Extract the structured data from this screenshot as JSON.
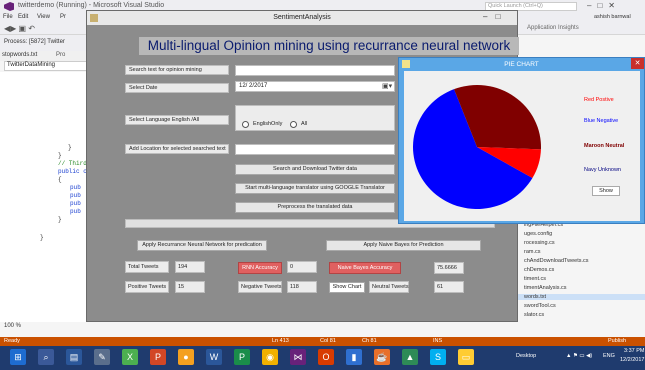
{
  "vs": {
    "title": "twitterdemo (Running) - Microsoft Visual Studio",
    "quick_launch": "Quick Launch (Ctrl+Q)",
    "user": "ashish barnwal",
    "menu": [
      "File",
      "Edit",
      "View",
      "Pr"
    ],
    "toolbar_right": "Application Insights",
    "process": "Process: [5872] Twitter",
    "tab_file": "stopwords.txt",
    "tab_other": "Pro",
    "nav_dropdown": "TwitterDataMining",
    "code_lines": [
      "}",
      "}",
      "// Third",
      "public c",
      "{",
      "pub",
      "pub",
      "pub",
      "pub",
      "}",
      "}"
    ],
    "zoom": "100 %",
    "solution_items": [
      "ingFileHelper.cs",
      "uges.config",
      "rocessing.cs",
      "ram.cs",
      "chAndDownloadTweets.cs",
      "chDemos.cs",
      "timent.cs",
      "timentAnalysis.cs",
      "words.txt",
      "swordTool.cs",
      "slator.cs"
    ],
    "selected_solution_item": "words.txt"
  },
  "status": {
    "ready": "Ready",
    "ln": "Ln 413",
    "col": "Col 81",
    "ch": "Ch 81",
    "ins": "INS",
    "publish": "Publish"
  },
  "taskbar": {
    "desktop": "Desktop",
    "lang": "ENG",
    "time": "3:37 PM",
    "date": "12/2/2017"
  },
  "app": {
    "window_title": "SentimentAnalysis",
    "heading": "Multi-lingual Opinion mining using recurrance neural network",
    "search_label": "Search text for opinion mining",
    "search_value": "",
    "date_label": "Select Date",
    "date_value": "12/ 2/2017",
    "language_label": "Select Language English /All",
    "radio_english": "EnglishOnly",
    "radio_all": "All",
    "location_label": "Add Location for selected searched text",
    "location_value": "",
    "btn_search_download": "Search and Download Twitter data",
    "btn_translate": "Start multi-language translator using GOOGLE Translator",
    "btn_preprocess": "Preprocess the translated data",
    "btn_rnn": "Apply Recurrance Neural Network for predication",
    "btn_naive": "Apply Naive Bayes for Prediction",
    "total_tweets_label": "Total Tweets",
    "total_tweets_value": "194",
    "rnn_accuracy_label": "RNN Accuracy",
    "rnn_accuracy_value": "0",
    "naive_accuracy_label": "Naive Bayes Accuracy",
    "naive_accuracy_value": "75.6666",
    "positive_label": "Positive Tweets",
    "positive_value": "15",
    "negative_label": "Negative Tweets",
    "negative_value": "118",
    "show_chart": "Show Chart",
    "neutral_label": "Neutral Tweets",
    "neutral_value": "61"
  },
  "pie": {
    "title": "PIE CHART",
    "show_button": "Show",
    "legend": [
      {
        "text": "Red Postive",
        "color": "#ff0000"
      },
      {
        "text": "Blue Negative",
        "color": "#0000ff"
      },
      {
        "text": "Maroon Neutral",
        "color": "#800000"
      },
      {
        "text": "Navy Unknown",
        "color": "#000080"
      }
    ]
  },
  "chart_data": {
    "type": "pie",
    "categories": [
      "Positive",
      "Negative",
      "Neutral"
    ],
    "values": [
      15,
      118,
      61
    ],
    "colors": [
      "#ff0000",
      "#0000ff",
      "#800000"
    ],
    "legend_placement": "right"
  }
}
